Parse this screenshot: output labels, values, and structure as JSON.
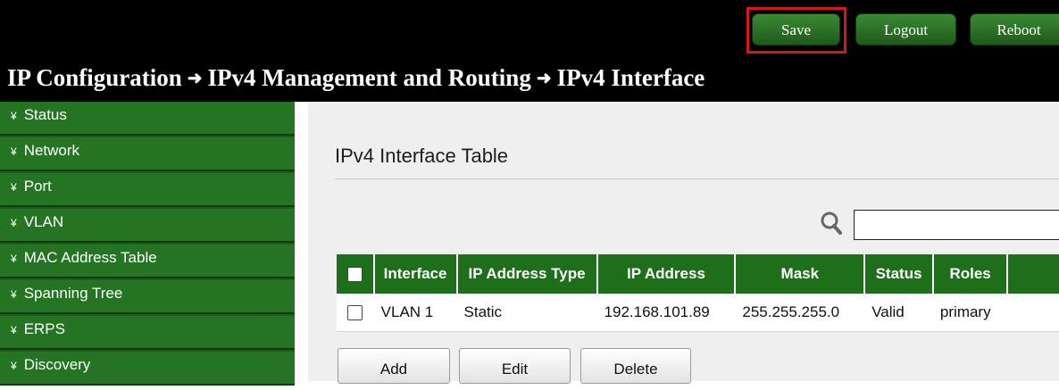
{
  "header": {
    "buttons": {
      "save": "Save",
      "logout": "Logout",
      "reboot": "Reboot"
    }
  },
  "breadcrumb": {
    "items": [
      "IP Configuration",
      "IPv4 Management and Routing",
      "IPv4 Interface"
    ],
    "separator": "➜"
  },
  "sidebar": {
    "items": [
      {
        "label": "Status"
      },
      {
        "label": "Network"
      },
      {
        "label": "Port"
      },
      {
        "label": "VLAN"
      },
      {
        "label": "MAC Address Table"
      },
      {
        "label": "Spanning Tree"
      },
      {
        "label": "ERPS"
      },
      {
        "label": "Discovery"
      }
    ]
  },
  "main": {
    "title": "IPv4 Interface Table",
    "search": {
      "value": "",
      "placeholder": ""
    },
    "table": {
      "columns": [
        "Interface",
        "IP Address Type",
        "IP Address",
        "Mask",
        "Status",
        "Roles"
      ],
      "rows": [
        [
          "VLAN 1",
          "Static",
          "192.168.101.89",
          "255.255.255.0",
          "Valid",
          "primary"
        ]
      ]
    },
    "actions": {
      "add": "Add",
      "edit": "Edit",
      "delete": "Delete"
    }
  },
  "colors": {
    "topbar": "#000000",
    "sidebar_green": "#257423",
    "header_green": "#1f6e1c",
    "highlight_red": "#d81818"
  }
}
